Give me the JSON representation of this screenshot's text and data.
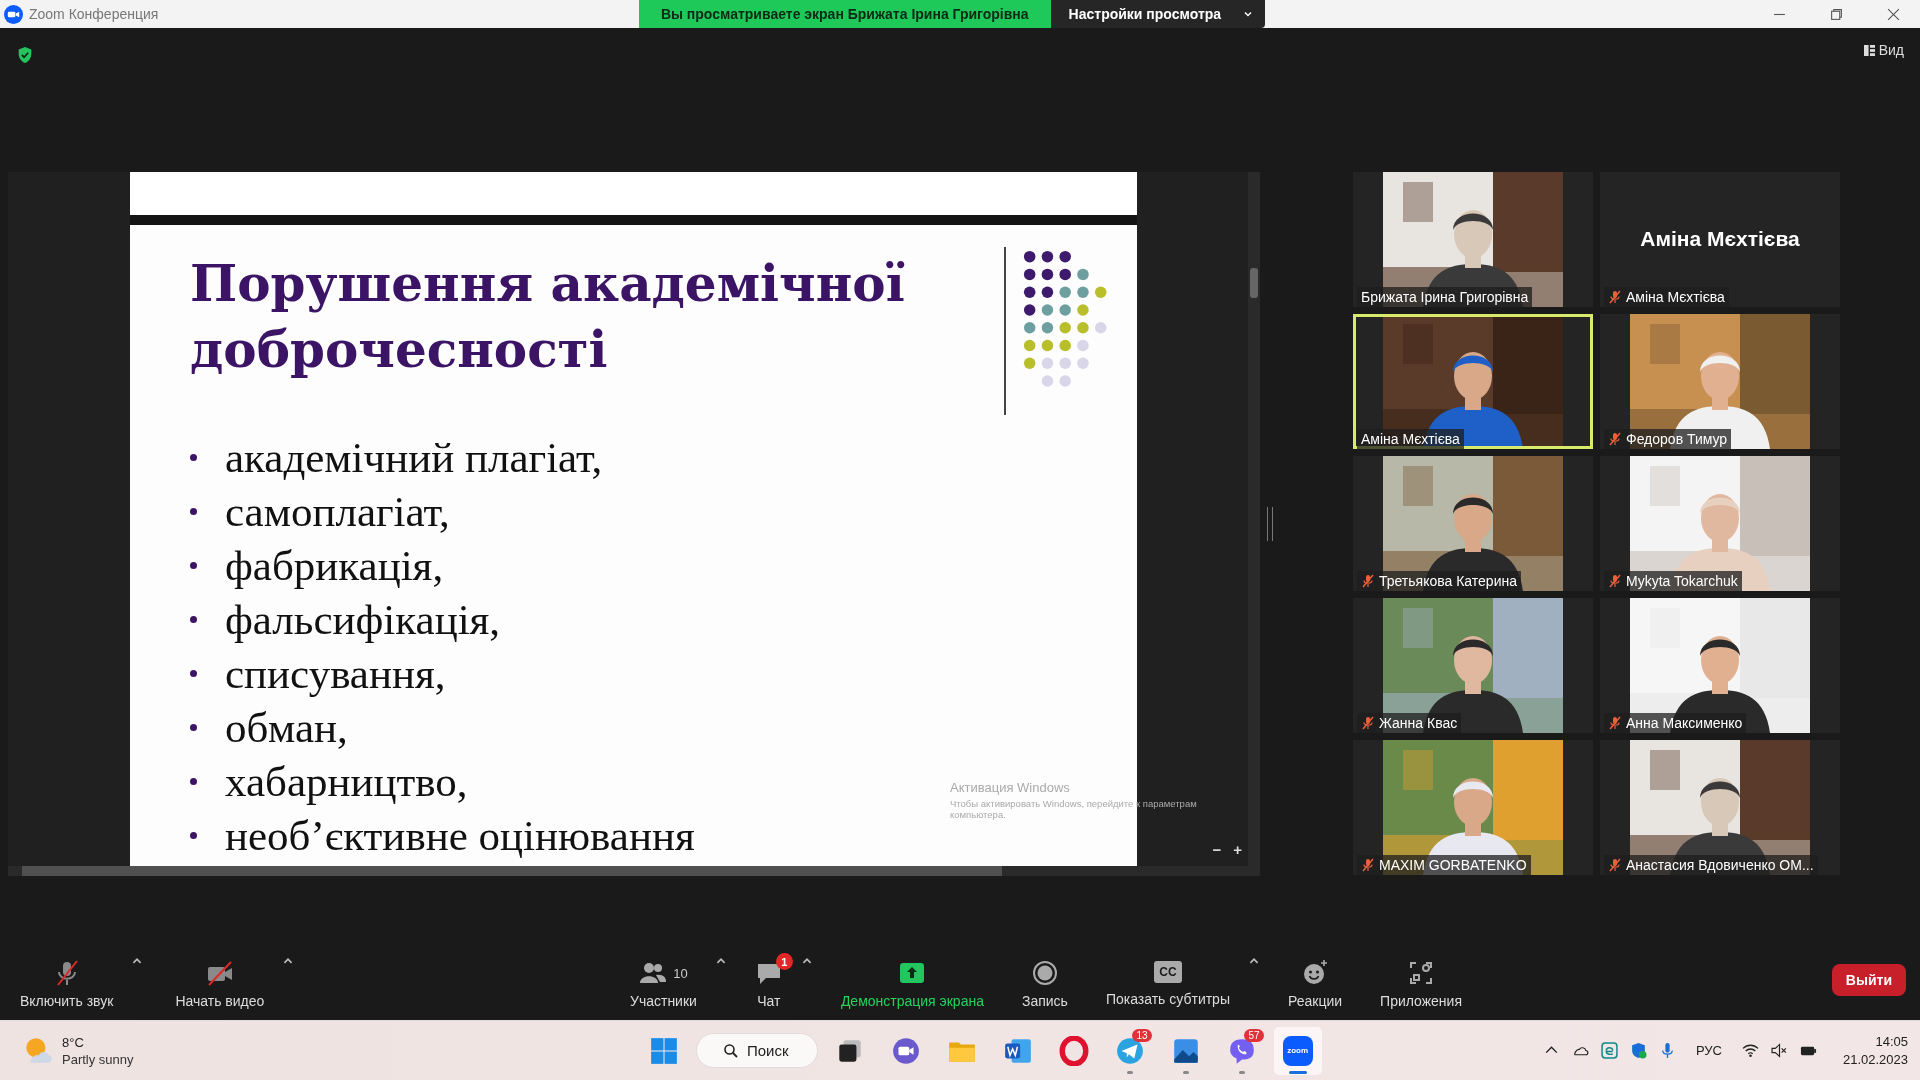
{
  "window": {
    "title": "Zoom Конференция"
  },
  "share_banner": {
    "text": "Вы просматриваете экран Брижата Ірина Григорівна",
    "options_button": "Настройки просмотра"
  },
  "view_button": "Вид",
  "slide": {
    "title": "Порушення академічної доброчесності",
    "bullets": [
      "академічний плагіат,",
      "самоплагіат,",
      "фабрикація,",
      "фальсифікація,",
      "списування,",
      "обман,",
      "хабарництво,",
      "необ’єктивне оцінювання"
    ]
  },
  "activation_notice": {
    "title": "Активация Windows",
    "text": "Чтобы активировать Windows, перейдите к параметрам компьютера."
  },
  "zoom_controls": [
    "−",
    "+"
  ],
  "participants": [
    {
      "name": "Брижата Ірина Григорівна",
      "kind": "video",
      "muted": false,
      "speaking": false
    },
    {
      "name": "Аміна Мєхтієва",
      "display_name": "Аміна Мєхтієва",
      "kind": "name",
      "muted": true,
      "speaking": false
    },
    {
      "name": "Аміна Мєхтієва",
      "kind": "video",
      "muted": false,
      "speaking": true
    },
    {
      "name": "Федоров Тимур",
      "kind": "video",
      "muted": true,
      "speaking": false
    },
    {
      "name": "Третьякова Катерина",
      "kind": "video",
      "muted": true,
      "speaking": false
    },
    {
      "name": "Mykyta Tokarchuk",
      "kind": "video",
      "muted": true,
      "speaking": false
    },
    {
      "name": "Жанна Квас",
      "kind": "video",
      "muted": true,
      "speaking": false
    },
    {
      "name": "Анна Максименко",
      "kind": "video",
      "muted": true,
      "speaking": false
    },
    {
      "name": "MAXIM GORBATENKO",
      "kind": "video",
      "muted": true,
      "speaking": false
    },
    {
      "name": "Анастасия Вдовиченко ОМ...",
      "kind": "video",
      "muted": true,
      "speaking": false
    }
  ],
  "toolbar": {
    "left": [
      {
        "kind": "audio",
        "label": "Включить звук",
        "caret": true
      },
      {
        "kind": "video",
        "label": "Начать видео",
        "caret": true
      }
    ],
    "center": [
      {
        "kind": "participants",
        "label": "Участники",
        "count": "10",
        "caret": true
      },
      {
        "kind": "chat",
        "label": "Чат",
        "badge": "1",
        "caret": true
      },
      {
        "kind": "share",
        "label": "Демонстрация экрана",
        "highlighted": true,
        "caret": false
      },
      {
        "kind": "record",
        "label": "Запись",
        "caret": false
      },
      {
        "kind": "captions",
        "label": "Показать субтитры",
        "icon_text": "CC",
        "caret": true
      },
      {
        "kind": "reactions",
        "label": "Реакции",
        "caret": false
      },
      {
        "kind": "apps",
        "label": "Приложения",
        "caret": false
      }
    ],
    "leave_button": "Выйти"
  },
  "taskbar": {
    "weather": {
      "temperature": "8°C",
      "condition": "Partly sunny"
    },
    "search": "Поиск",
    "apps": [
      {
        "kind": "start",
        "running": false,
        "selected": false
      },
      {
        "kind": "taskview",
        "running": false,
        "selected": false
      },
      {
        "kind": "meet",
        "running": false,
        "selected": false
      },
      {
        "kind": "explorer",
        "running": false,
        "selected": false
      },
      {
        "kind": "word",
        "running": false,
        "selected": false
      },
      {
        "kind": "opera",
        "running": false,
        "selected": false
      },
      {
        "kind": "telegram",
        "badge": "13",
        "running": true,
        "selected": false
      },
      {
        "kind": "photos",
        "running": true,
        "selected": false
      },
      {
        "kind": "viber",
        "badge": "57",
        "running": true,
        "selected": false
      },
      {
        "kind": "zoom",
        "icon_text": "zoom",
        "running": true,
        "selected": true
      }
    ],
    "language": "РУС",
    "time": "14:05",
    "date": "21.02.2023"
  }
}
